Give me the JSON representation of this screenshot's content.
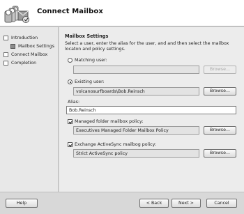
{
  "header": {
    "title": "Connect Mailbox"
  },
  "nav": {
    "items": [
      {
        "label": "Introduction",
        "state": "empty"
      },
      {
        "label": "Mailbox Settings",
        "state": "current"
      },
      {
        "label": "Connect Mailbox",
        "state": "empty"
      },
      {
        "label": "Completion",
        "state": "empty"
      }
    ]
  },
  "main": {
    "title": "Mailbox Settings",
    "description": "Select a user, enter the alias for the user, and and then select the mailbox locaton and policy settings.",
    "matching_user": {
      "label": "Matching user:",
      "value": "",
      "button": "Browse...",
      "selected": false
    },
    "existing_user": {
      "label": "Existing user:",
      "value": "volcanosurfboards\\Bob.Reinsch",
      "button": "Browse...",
      "selected": true
    },
    "alias": {
      "label": "Alias:",
      "value": "Bob.Reinsch"
    },
    "managed_policy": {
      "label": "Managed folder mailbox policy:",
      "value": "Executives Managed Folder Mailbox Policy",
      "button": "Browse...",
      "checked": true
    },
    "activesync_policy": {
      "label": "Exchange ActiveSync mailbog policy:",
      "value": "Strict ActiveSync policy",
      "button": "Browse...",
      "checked": true
    }
  },
  "footer": {
    "help": "Help",
    "back": "< Back",
    "next": "Next >",
    "cancel": "Cancel"
  },
  "colors": {
    "header_bg": "#ffffff",
    "panel_bg": "#ececec",
    "nav_bg": "#e8e8e8",
    "field_bg": "#e3e3e3"
  }
}
